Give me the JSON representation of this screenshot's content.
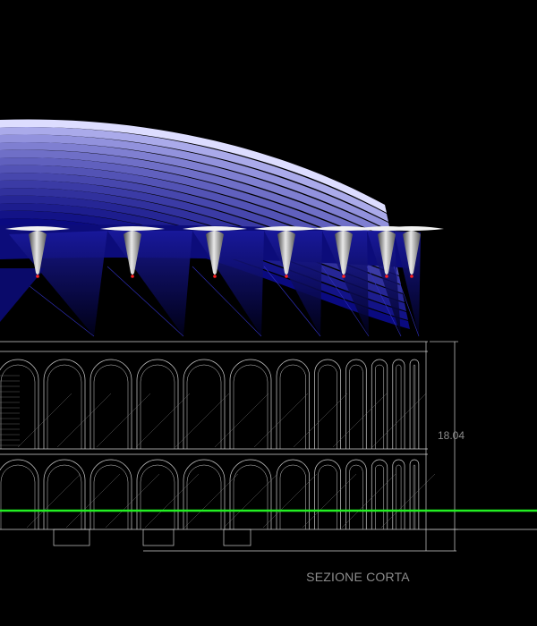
{
  "drawing": {
    "dimension_label": "18.04",
    "caption": "SEZIONE CORTA"
  },
  "colors": {
    "background": "#000000",
    "canopy_dark": "#0a0a80",
    "canopy_light": "#ddddff",
    "linework": "#cfcfcf",
    "ground_line": "#22ee22",
    "marker": "#ff2020",
    "text": "#8c8c8c"
  },
  "icons": [
    "lamp-icon"
  ]
}
